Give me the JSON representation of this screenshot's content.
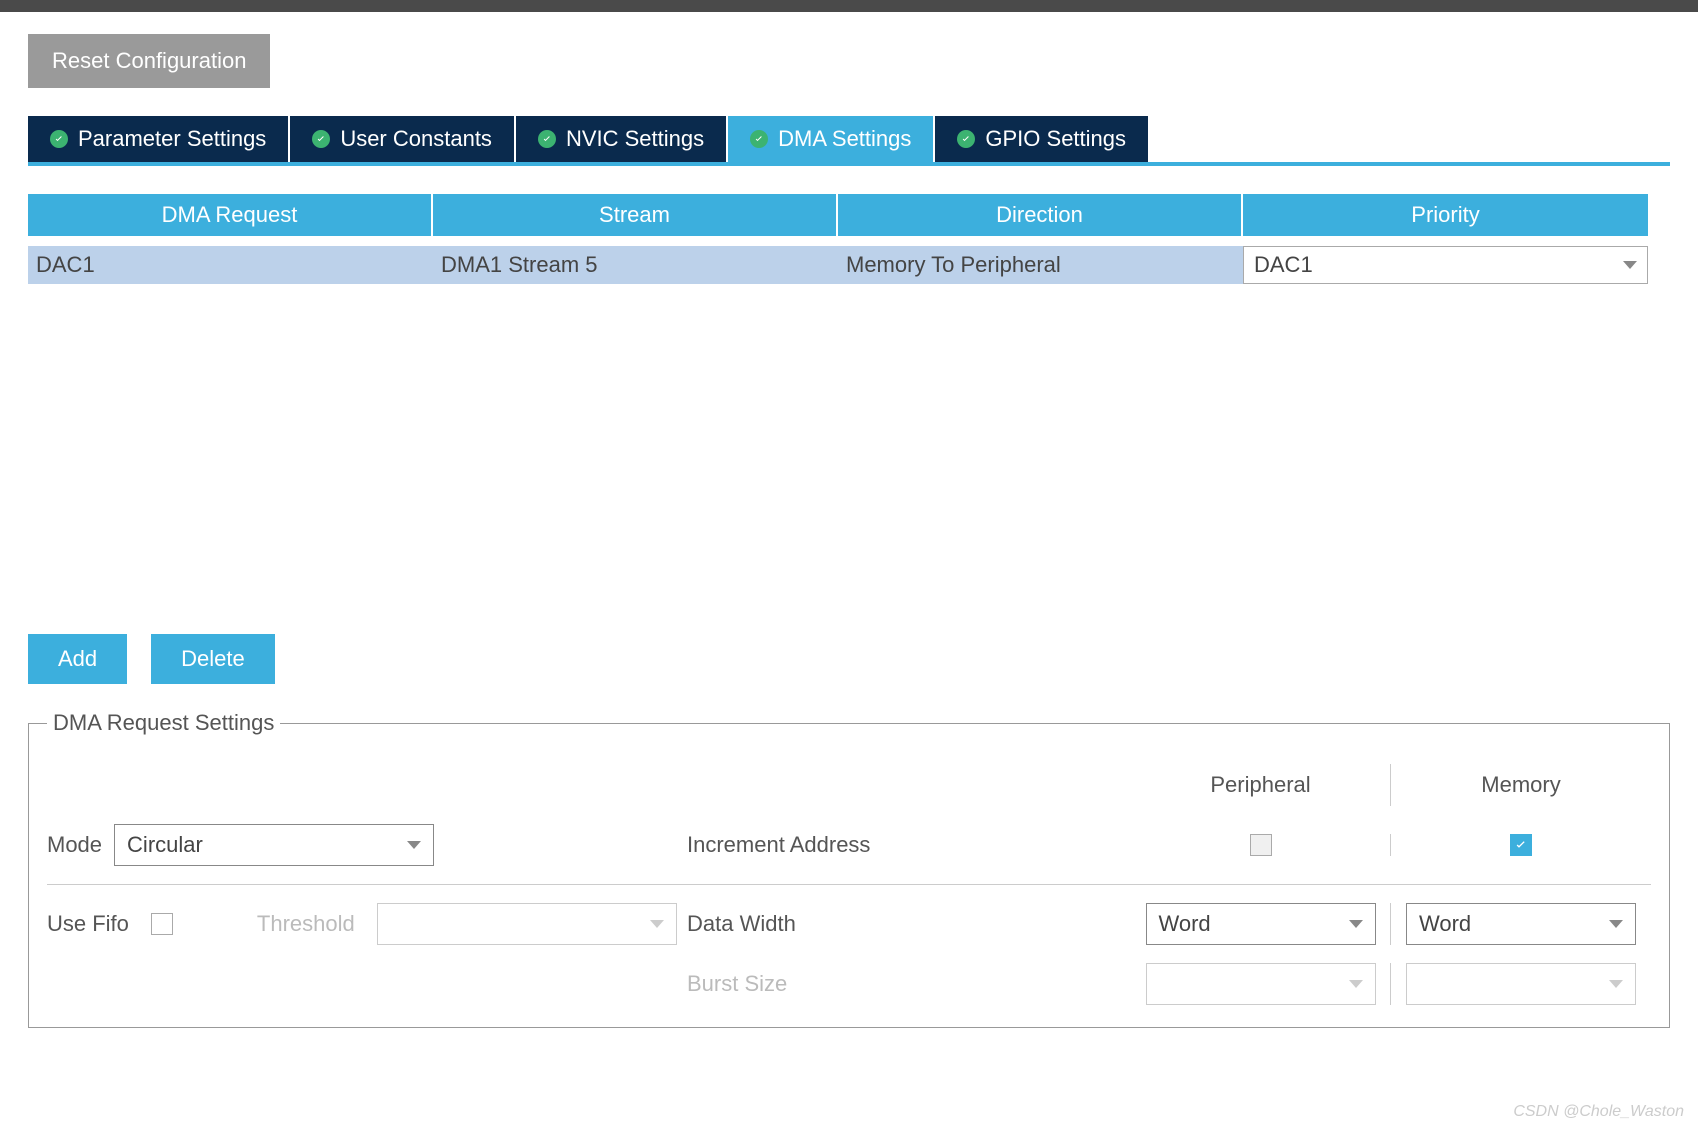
{
  "buttons": {
    "reset": "Reset Configuration",
    "add": "Add",
    "delete": "Delete"
  },
  "tabs": [
    {
      "label": "Parameter Settings",
      "active": false
    },
    {
      "label": "User Constants",
      "active": false
    },
    {
      "label": "NVIC Settings",
      "active": false
    },
    {
      "label": "DMA Settings",
      "active": true
    },
    {
      "label": "GPIO Settings",
      "active": false
    }
  ],
  "table": {
    "headers": [
      "DMA Request",
      "Stream",
      "Direction",
      "Priority"
    ],
    "row": {
      "request": "DAC1",
      "stream": "DMA1 Stream 5",
      "direction": "Memory To Peripheral",
      "priority": "DAC1"
    }
  },
  "settings": {
    "legend": "DMA Request Settings",
    "col_peripheral": "Peripheral",
    "col_memory": "Memory",
    "mode_label": "Mode",
    "mode_value": "Circular",
    "increment_label": "Increment Address",
    "increment_peripheral_checked": false,
    "increment_memory_checked": true,
    "use_fifo_label": "Use Fifo",
    "use_fifo_checked": false,
    "threshold_label": "Threshold",
    "threshold_value": "",
    "data_width_label": "Data Width",
    "data_width_peripheral": "Word",
    "data_width_memory": "Word",
    "burst_size_label": "Burst Size",
    "burst_size_peripheral": "",
    "burst_size_memory": ""
  },
  "watermark": "CSDN @Chole_Waston"
}
